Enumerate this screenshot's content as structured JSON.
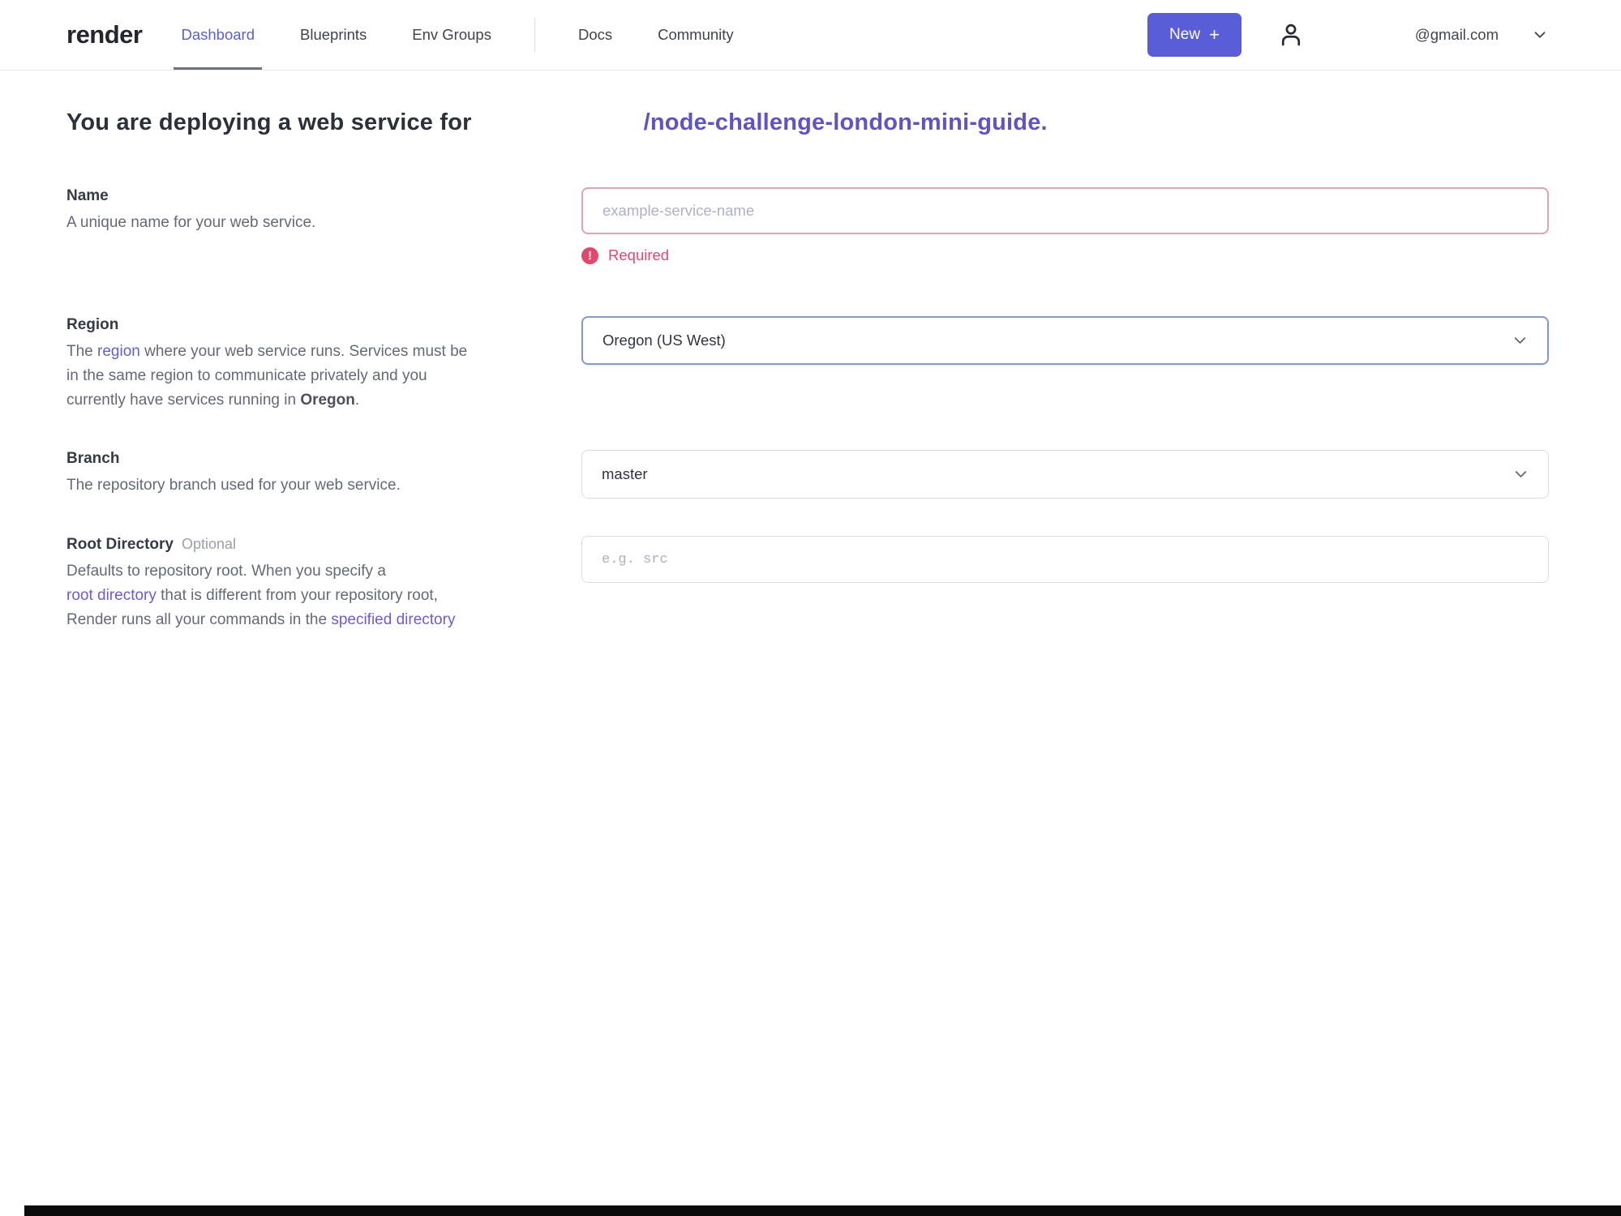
{
  "nav": {
    "logo_text": "render",
    "items": [
      {
        "label": "Dashboard"
      },
      {
        "label": "Blueprints"
      },
      {
        "label": "Env Groups"
      },
      {
        "label": "Docs"
      },
      {
        "label": "Community"
      }
    ],
    "new_button_label": "New",
    "new_button_icon": "+",
    "account_email": "@gmail.com"
  },
  "heading": {
    "prefix": "You are deploying a web service for",
    "repo_link": "/node-challenge-london-mini-guide."
  },
  "form": {
    "name": {
      "label": "Name",
      "description": "A unique name for your web service.",
      "placeholder": "example-service-name",
      "error_icon": "!",
      "error_text": "Required"
    },
    "region": {
      "label": "Region",
      "desc_t1": "The ",
      "desc_link1": "region",
      "desc_t2a": " where your web service runs. Services must be",
      "desc_t2b": "in the same region to communicate privately and you",
      "desc_t2c": "currently have services running in ",
      "desc_bold": "Oregon",
      "desc_t3": ".",
      "value": "Oregon (US West)"
    },
    "branch": {
      "label": "Branch",
      "description": "The repository branch used for your web service.",
      "value": "master"
    },
    "root_directory": {
      "label": "Root Directory",
      "optional_tag": "Optional",
      "desc_t1": "Defaults to repository root. When you specify a",
      "desc_link1": "root directory",
      "desc_t2a": " that is different from your repository root,",
      "desc_t2b": "Render runs all your commands in the ",
      "desc_link2": "specified directory",
      "placeholder": "e.g. src"
    }
  },
  "colors": {
    "accent_indigo": "#5a5dd8",
    "active_nav": "#5a61c9",
    "link_purple": "#5e54c8",
    "error_red": "#e2486b",
    "error_border": "#e0a3b4",
    "focus_border": "#8498d2",
    "bottom_bar": "#0b0b0b"
  }
}
